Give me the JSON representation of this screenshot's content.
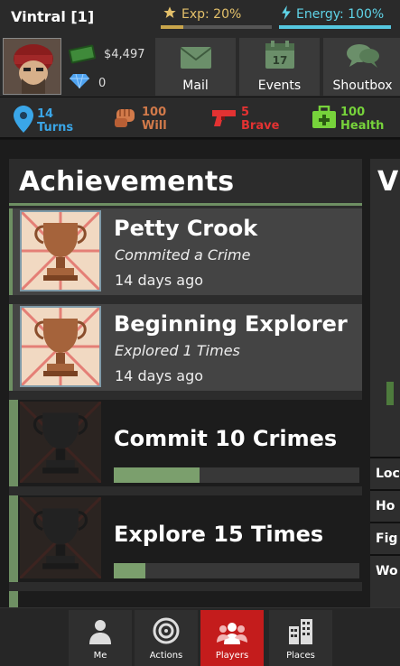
{
  "header": {
    "player_name": "Vintral [1]",
    "exp_label": "Exp: 20%",
    "exp_percent": 20,
    "energy_label": "Energy: 100%",
    "energy_percent": 100,
    "money": "$4,497",
    "gems": "0",
    "tiles": [
      {
        "label": "Mail",
        "icon": "mail-icon"
      },
      {
        "label": "Events",
        "icon": "calendar-icon"
      },
      {
        "label": "Shoutbox",
        "icon": "chat-bubbles-icon"
      }
    ]
  },
  "stats": {
    "turns": {
      "value": "14",
      "label": "Turns",
      "icon": "map-pin-icon",
      "color": "#3aa6e8"
    },
    "will": {
      "value": "100",
      "label": "Will",
      "icon": "fist-icon",
      "color": "#d27a4a"
    },
    "brave": {
      "value": "5",
      "label": "Brave",
      "icon": "gun-icon",
      "color": "#e33232"
    },
    "health": {
      "value": "100",
      "label": "Health",
      "icon": "medkit-icon",
      "color": "#77d33b"
    }
  },
  "achievements_panel": {
    "title": "Achievements",
    "items": [
      {
        "title": "Petty Crook",
        "description": "Commited a Crime",
        "time": "14 days ago",
        "unlocked": true
      },
      {
        "title": "Beginning Explorer",
        "description": "Explored 1 Times",
        "time": "14 days ago",
        "unlocked": true
      },
      {
        "title": "Commit 10 Crimes",
        "unlocked": false,
        "progress": 0.35
      },
      {
        "title": "Explore 15 Times",
        "unlocked": false,
        "progress": 0.13
      }
    ]
  },
  "side_panel": {
    "title": "V",
    "items": [
      "Loc",
      "Ho",
      "Fig",
      "Wo"
    ]
  },
  "bottom_nav": {
    "items": [
      {
        "label": "Me",
        "icon": "person-icon"
      },
      {
        "label": "Actions",
        "icon": "target-icon"
      },
      {
        "label": "Players",
        "icon": "group-icon",
        "active": true
      },
      {
        "label": "Places",
        "icon": "buildings-icon"
      }
    ]
  },
  "colors": {
    "accent_green": "#6e8f63",
    "active_nav": "#c41c1c",
    "exp_gold": "#c9a54b",
    "energy_cyan": "#55c7df"
  }
}
